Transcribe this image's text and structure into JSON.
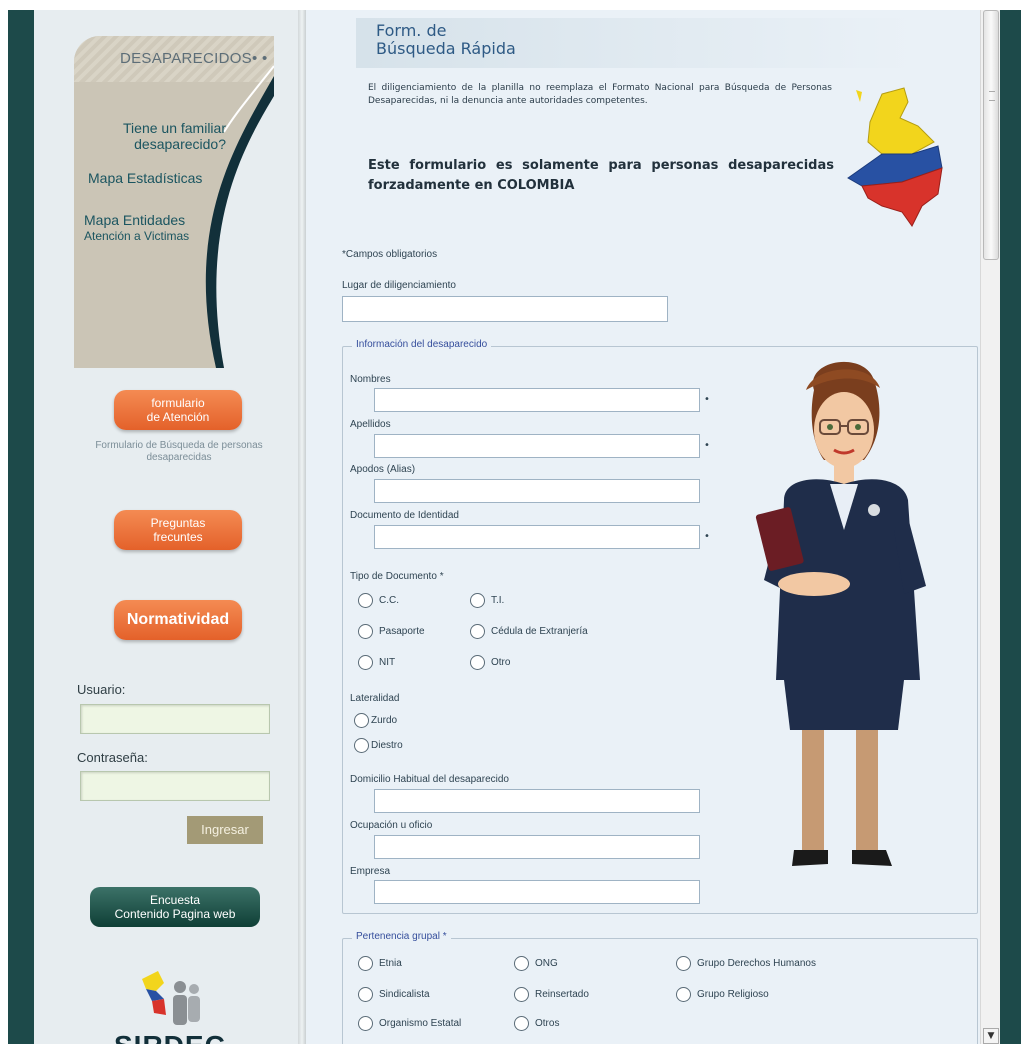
{
  "sidebar": {
    "heading": "DESAPARECIDOS",
    "nav": [
      {
        "line1": "Tiene un familiar",
        "line2": "desaparecido?"
      },
      {
        "line1": "Mapa Estadísticas"
      },
      {
        "line1": "Mapa Entidades",
        "line2": "Atención a Victimas"
      }
    ],
    "form_button": {
      "line1": "formulario",
      "line2": "de Atención"
    },
    "form_caption": "Formulario de Búsqueda de personas desaparecidas",
    "faq_button": {
      "line1": "Preguntas",
      "line2": "frecuntes"
    },
    "norm_button": "Normatividad",
    "login": {
      "user_label": "Usuario:",
      "password_label": "Contraseña:",
      "submit": "Ingresar"
    },
    "survey_button": {
      "line1": "Encuesta",
      "line2": "Contenido Pagina web"
    },
    "logo_text": "SIRDEC"
  },
  "main": {
    "title_line1": "Form. de",
    "title_line2": "Búsqueda Rápida",
    "intro": "El diligenciamiento de la planilla no reemplaza el Formato Nacional para Búsqueda de Personas Desaparecidas, ni la denuncia ante autoridades competentes.",
    "notice": "Este formulario es solamente para personas desaparecidas forzadamente en COLOMBIA",
    "required_note": "Campos obligatorios",
    "required_mark": "*",
    "field_dot": "•",
    "place_label": "Lugar de diligenciamiento",
    "section_info": "Información del desaparecido",
    "fields": {
      "nombres": "Nombres",
      "apellidos": "Apellidos",
      "apodos": "Apodos (Alias)",
      "documento": "Documento de Identidad",
      "tipo_documento": "Tipo de Documento",
      "lateralidad": "Lateralidad",
      "domicilio": "Domicilio Habitual del desaparecido",
      "ocupacion": "Ocupación u oficio",
      "empresa": "Empresa"
    },
    "doc_types": [
      "C.C.",
      "T.I.",
      "Pasaporte",
      "Cédula de Extranjería",
      "NIT",
      "Otro"
    ],
    "laterality": [
      "Zurdo",
      "Diestro"
    ],
    "section_group": "Pertenencia grupal",
    "groups": [
      "Etnia",
      "ONG",
      "Grupo Derechos Humanos",
      "Sindicalista",
      "Reinsertado",
      "Grupo Religioso",
      "Organismo Estatal",
      "Otros"
    ]
  },
  "colors": {
    "frame": "#1d4a4a",
    "accent_orange": "#e4612a",
    "legend_blue": "#354e9c",
    "title_blue": "#2e5a85"
  }
}
